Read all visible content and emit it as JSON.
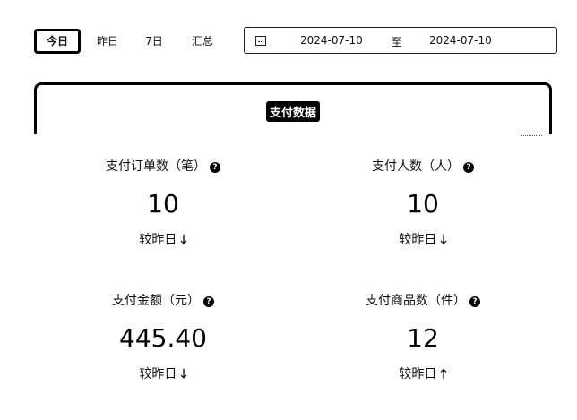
{
  "tabs": [
    {
      "label": "今日",
      "active": true
    },
    {
      "label": "昨日",
      "active": false
    },
    {
      "label": "7日",
      "active": false
    },
    {
      "label": "汇总",
      "active": false
    }
  ],
  "date_range": {
    "icon": "calendar-icon",
    "start": "2024-07-10",
    "separator": "至",
    "end": "2024-07-10"
  },
  "section": {
    "title": "支付数据"
  },
  "metrics": [
    {
      "label": "支付订单数（笔）",
      "value": "10",
      "compare_label": "较昨日",
      "arrow": "🡓",
      "trend": "down",
      "help_icon": "help-icon"
    },
    {
      "label": "支付人数（人）",
      "value": "10",
      "compare_label": "较昨日",
      "arrow": "🡓",
      "trend": "down",
      "help_icon": "help-icon"
    },
    {
      "label": "支付金额（元）",
      "value": "445.40",
      "compare_label": "较昨日",
      "arrow": "🡓",
      "trend": "down",
      "help_icon": "help-icon"
    },
    {
      "label": "支付商品数（件）",
      "value": "12",
      "compare_label": "较昨日",
      "arrow": "🡑",
      "trend": "up",
      "help_icon": "help-icon"
    }
  ]
}
